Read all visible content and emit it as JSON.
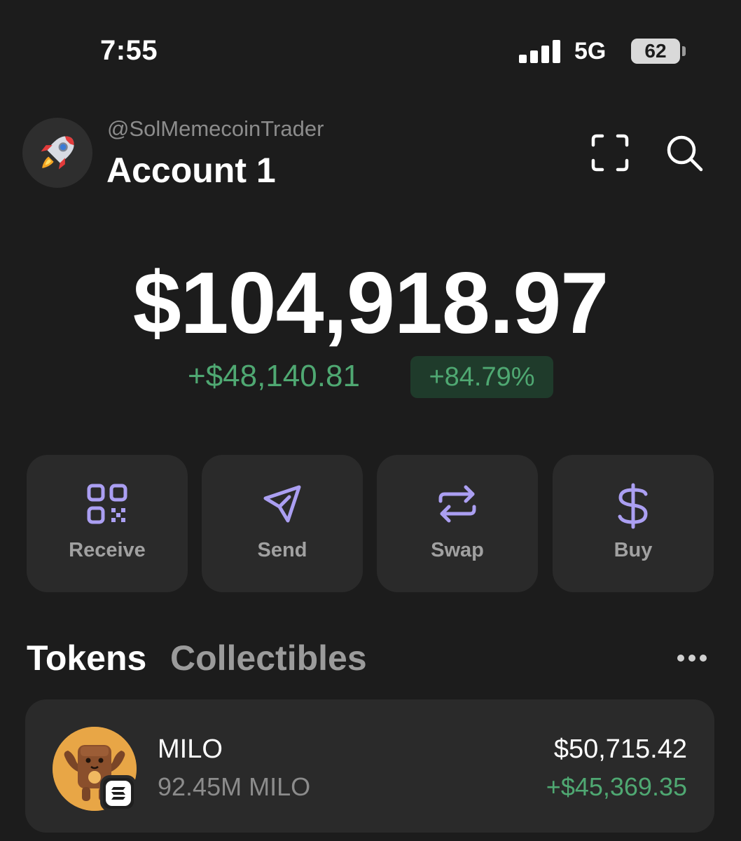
{
  "status_bar": {
    "time": "7:55",
    "network": "5G",
    "battery": "62"
  },
  "header": {
    "handle": "@SolMemecoinTrader",
    "account_name": "Account 1",
    "avatar_icon": "rocket-icon",
    "scan_icon": "scan-frame-icon",
    "search_icon": "search-icon"
  },
  "balance": {
    "total": "$104,918.97",
    "change_amount": "+$48,140.81",
    "change_percent": "+84.79%"
  },
  "actions": [
    {
      "label": "Receive",
      "icon": "qr-code-icon"
    },
    {
      "label": "Send",
      "icon": "send-arrow-icon"
    },
    {
      "label": "Swap",
      "icon": "swap-arrows-icon"
    },
    {
      "label": "Buy",
      "icon": "dollar-icon"
    }
  ],
  "tabs": {
    "tokens": "Tokens",
    "collectibles": "Collectibles"
  },
  "tokens": [
    {
      "name": "MILO",
      "amount": "92.45M MILO",
      "value": "$50,715.42",
      "pnl": "+$45,369.35",
      "chain_icon": "solana-icon"
    }
  ],
  "colors": {
    "background": "#1c1c1c",
    "card": "#2a2a2a",
    "accent": "#ab9ff2",
    "positive": "#4fa872"
  }
}
